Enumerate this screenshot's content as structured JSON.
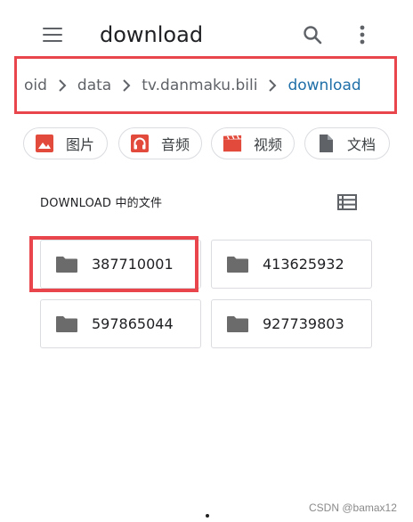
{
  "app_bar": {
    "title": "download",
    "menu_icon": "menu-icon",
    "search_icon": "search-icon",
    "more_icon": "more-vert-icon"
  },
  "breadcrumb": {
    "items": [
      "oid",
      "data",
      "tv.danmaku.bili",
      "download"
    ],
    "separator_icon": "chevron-right-icon"
  },
  "chips": [
    {
      "label": "图片",
      "icon": "image-icon",
      "color": "#e24a3c"
    },
    {
      "label": "音频",
      "icon": "headphones-icon",
      "color": "#e24a3c"
    },
    {
      "label": "视频",
      "icon": "movie-icon",
      "color": "#e24a3c"
    },
    {
      "label": "文档",
      "icon": "document-icon",
      "color": "#5f6368"
    }
  ],
  "section": {
    "title": "DOWNLOAD 中的文件",
    "view_toggle_icon": "list-view-icon"
  },
  "folders": [
    {
      "name": "387710001",
      "icon": "folder-icon"
    },
    {
      "name": "413625932",
      "icon": "folder-icon"
    },
    {
      "name": "597865044",
      "icon": "folder-icon"
    },
    {
      "name": "927739803",
      "icon": "folder-icon"
    }
  ],
  "colors": {
    "highlight_border": "#e8454c",
    "accent": "#1f6fa8",
    "icon_gray": "#5f6368"
  },
  "watermark": "CSDN @bamax12"
}
